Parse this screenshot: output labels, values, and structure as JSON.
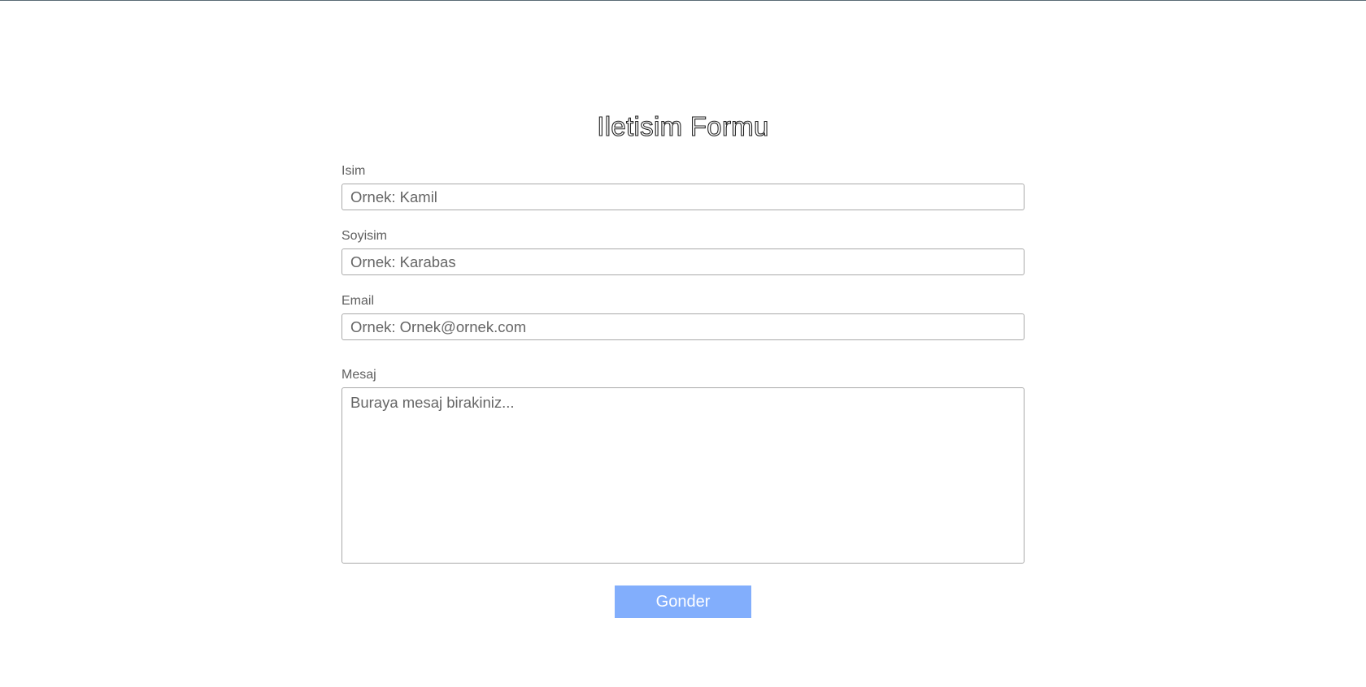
{
  "form": {
    "title": "Iletisim Formu",
    "fields": [
      {
        "label": "Isim",
        "placeholder": "Ornek: Kamil"
      },
      {
        "label": "Soyisim",
        "placeholder": "Ornek: Karabas"
      },
      {
        "label": "Email",
        "placeholder": "Ornek: Ornek@ornek.com"
      }
    ],
    "message": {
      "label": "Mesaj",
      "placeholder": "Buraya mesaj birakiniz..."
    },
    "submit_label": "Gonder"
  },
  "colors": {
    "button_bg": "#82aefc",
    "top_rule": "#5a6b75"
  }
}
